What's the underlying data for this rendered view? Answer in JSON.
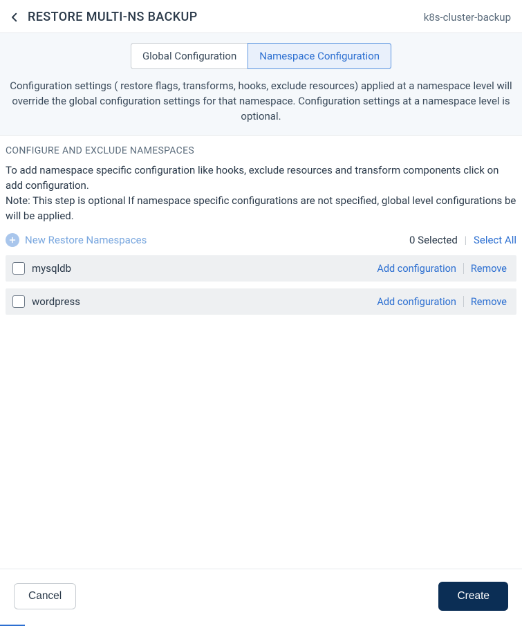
{
  "header": {
    "title": "RESTORE MULTI-NS BACKUP",
    "context": "k8s-cluster-backup"
  },
  "tabs": {
    "global": "Global Configuration",
    "namespace": "Namespace Configuration",
    "description": "Configuration settings ( restore flags, transforms, hooks, exclude resources) applied at a namespace level will override the global configuration settings for that namespace. Configuration settings at a namespace level is optional."
  },
  "section": {
    "heading": "CONFIGURE AND EXCLUDE NAMESPACES",
    "help": "To add namespace specific configuration like hooks, exclude resources and transform components click on add configuration.\nNote: This step is optional If namespace specific configurations are not specified, global level configurations be will be applied."
  },
  "toolbar": {
    "addLabel": "New Restore Namespaces",
    "selectedLabel": "0 Selected",
    "selectAll": "Select All"
  },
  "rowActions": {
    "addConfig": "Add configuration",
    "remove": "Remove"
  },
  "namespaces": [
    {
      "name": "mysqldb"
    },
    {
      "name": "wordpress"
    }
  ],
  "footer": {
    "cancel": "Cancel",
    "create": "Create"
  }
}
